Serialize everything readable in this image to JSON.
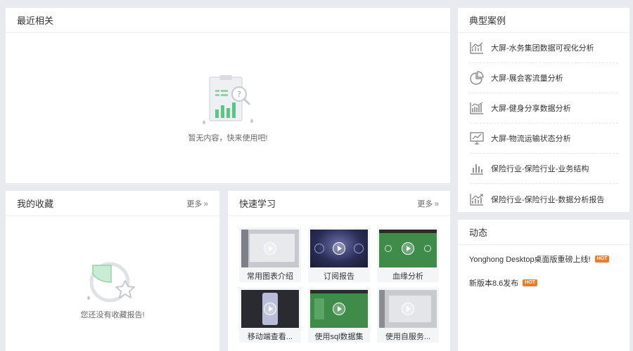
{
  "recent": {
    "title": "最近相关",
    "empty_text": "暂无内容，快来使用吧!"
  },
  "favorites": {
    "title": "我的收藏",
    "more_label": "更多",
    "empty_text": "您还没有收藏报告!"
  },
  "quick": {
    "title": "快速学习",
    "more_label": "更多",
    "videos": [
      {
        "label": "常用图表介绍"
      },
      {
        "label": "订阅报告"
      },
      {
        "label": "血缘分析"
      },
      {
        "label": "移动端查看..."
      },
      {
        "label": "使用sql数据集"
      },
      {
        "label": "使用自服务..."
      }
    ]
  },
  "cases": {
    "title": "典型案例",
    "items": [
      {
        "label": "大屏-水务集团数据可视化分析",
        "icon": "line-trend-icon"
      },
      {
        "label": "大屏-展会客流量分析",
        "icon": "pie-chart-icon"
      },
      {
        "label": "大屏-健身分享数据分析",
        "icon": "bar-trend-icon"
      },
      {
        "label": "大屏-物流运输状态分析",
        "icon": "monitor-chart-icon"
      },
      {
        "label": "保险行业-保险行业-业务结构",
        "icon": "bar-chart-icon"
      },
      {
        "label": "保险行业-保险行业-数据分析报告",
        "icon": "bar-trend-icon"
      }
    ]
  },
  "news": {
    "title": "动态",
    "items": [
      {
        "label": "Yonghong Desktop桌面版重磅上线!",
        "badge": "HOT"
      },
      {
        "label": "新版本8.6发布",
        "badge": "HOT"
      }
    ]
  },
  "colors": {
    "accent_green": "#2e9e56",
    "hot_badge": "#f07a25",
    "page_bg": "#e9eaef"
  }
}
